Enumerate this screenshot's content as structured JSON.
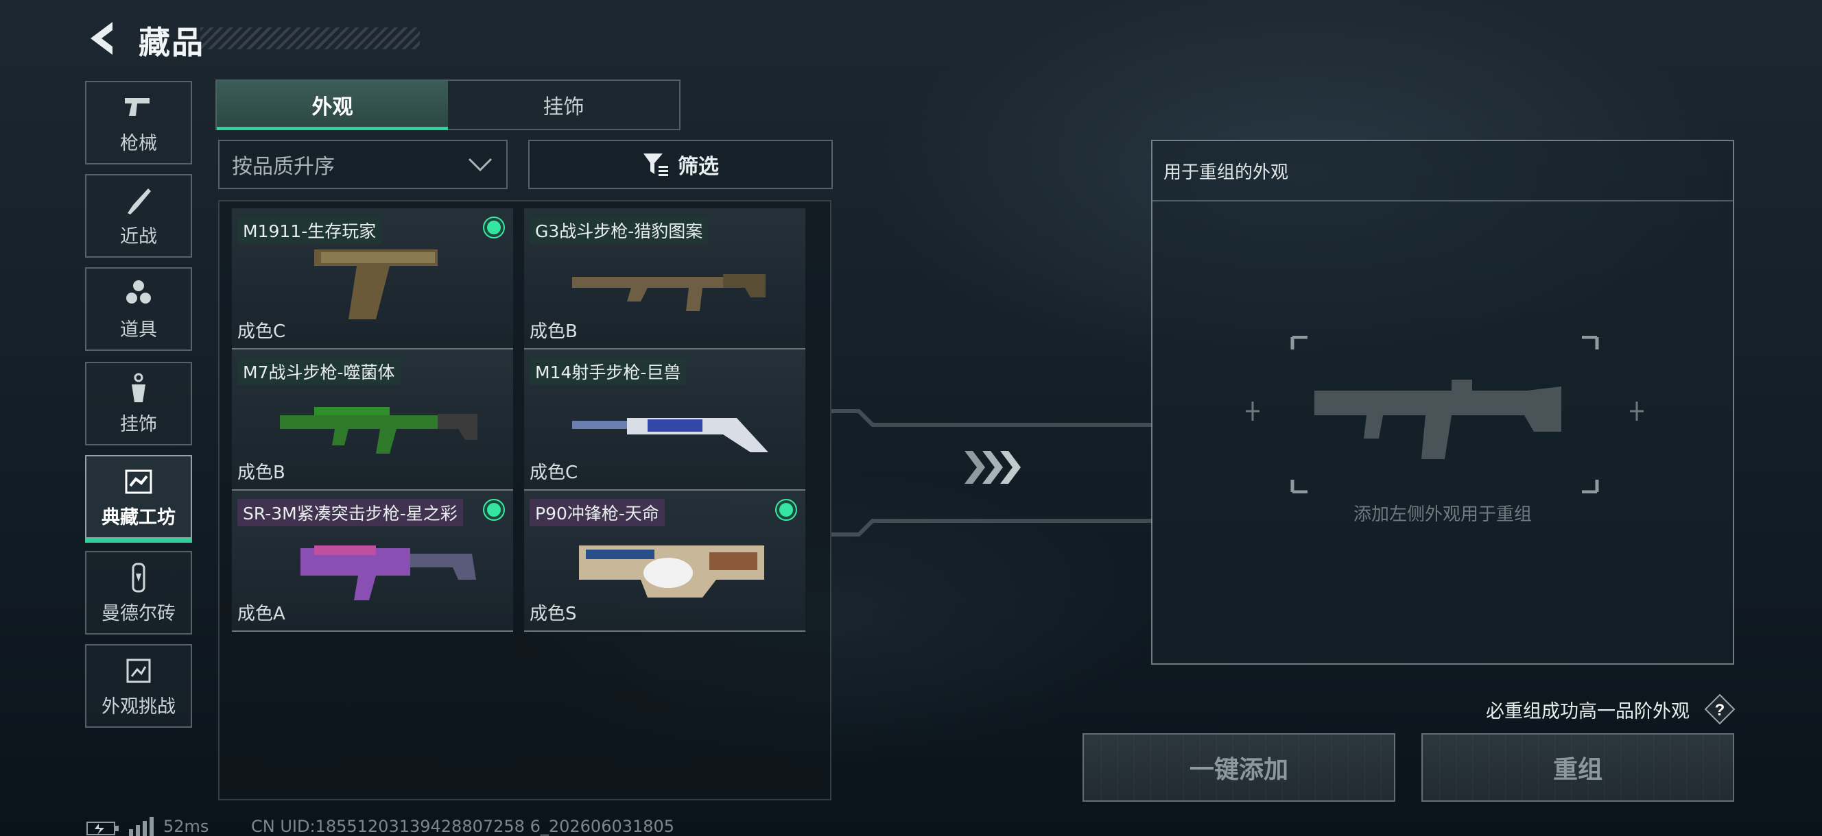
{
  "header": {
    "title": "藏品"
  },
  "sidebar": {
    "items": [
      {
        "label": "枪械",
        "icon": "pistol-icon"
      },
      {
        "label": "近战",
        "icon": "knife-icon"
      },
      {
        "label": "道具",
        "icon": "grenade-icon"
      },
      {
        "label": "挂饰",
        "icon": "charm-icon"
      },
      {
        "label": "典藏工坊",
        "icon": "workshop-icon",
        "active": true
      },
      {
        "label": "曼德尔砖",
        "icon": "brick-icon"
      },
      {
        "label": "外观挑战",
        "icon": "challenge-icon"
      }
    ]
  },
  "tabs": [
    {
      "label": "外观",
      "active": true
    },
    {
      "label": "挂饰",
      "active": false
    }
  ],
  "sort": {
    "value": "按品质升序"
  },
  "filter": {
    "label": "筛选"
  },
  "items": [
    {
      "name": "M1911-生存玩家",
      "grade": "成色C",
      "selected": true
    },
    {
      "name": "G3战斗步枪-猎豹图案",
      "grade": "成色B",
      "selected": false
    },
    {
      "name": "M7战斗步枪-噬菌体",
      "grade": "成色B",
      "selected": false
    },
    {
      "name": "M14射手步枪-巨兽",
      "grade": "成色C",
      "selected": false
    },
    {
      "name": "SR-3M紧凑突击步枪-星之彩",
      "grade": "成色A",
      "selected": true
    },
    {
      "name": "P90冲锋枪-天命",
      "grade": "成色S",
      "selected": true
    }
  ],
  "recombine": {
    "title": "用于重组的外观",
    "hint": "添加左侧外观用于重组"
  },
  "guarantee": {
    "text": "必重组成功高一品阶外观",
    "help_icon": "question-icon"
  },
  "buttons": {
    "auto_add": "一键添加",
    "recombine": "重组"
  },
  "footer": {
    "ping": "52ms",
    "uid": "CN UID:18551203139428807258 6_202606031805"
  },
  "colors": {
    "accent": "#2fd39a",
    "selected_dot": "#35e6a2"
  }
}
